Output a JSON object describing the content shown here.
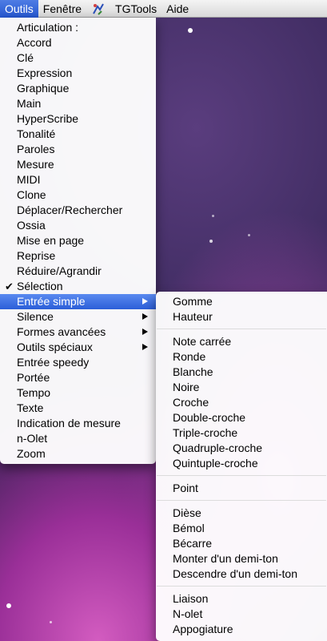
{
  "menubar": {
    "items": [
      {
        "label": "Outils",
        "active": true
      },
      {
        "label": "Fenêtre",
        "active": false
      },
      {
        "icon": "app-icon"
      },
      {
        "label": "TGTools",
        "active": false
      },
      {
        "label": "Aide",
        "active": false
      }
    ]
  },
  "tools_menu": {
    "items": [
      {
        "label": "Articulation :"
      },
      {
        "label": "Accord"
      },
      {
        "label": "Clé"
      },
      {
        "label": "Expression"
      },
      {
        "label": "Graphique"
      },
      {
        "label": "Main"
      },
      {
        "label": "HyperScribe"
      },
      {
        "label": "Tonalité"
      },
      {
        "label": "Paroles"
      },
      {
        "label": "Mesure"
      },
      {
        "label": "MIDI"
      },
      {
        "label": "Clone"
      },
      {
        "label": "Déplacer/Rechercher"
      },
      {
        "label": "Ossia"
      },
      {
        "label": "Mise en page"
      },
      {
        "label": "Reprise"
      },
      {
        "label": "Réduire/Agrandir"
      },
      {
        "label": "Sélection",
        "checked": true
      },
      {
        "label": "Entrée simple",
        "submenu": true,
        "highlighted": true
      },
      {
        "label": "Silence",
        "submenu": true
      },
      {
        "label": "Formes avancées",
        "submenu": true
      },
      {
        "label": "Outils spéciaux",
        "submenu": true
      },
      {
        "label": "Entrée speedy"
      },
      {
        "label": "Portée"
      },
      {
        "label": "Tempo"
      },
      {
        "label": "Texte"
      },
      {
        "label": "Indication de mesure"
      },
      {
        "label": "n-Olet"
      },
      {
        "label": "Zoom"
      }
    ]
  },
  "simple_entry_submenu": {
    "groups": [
      [
        "Gomme",
        "Hauteur"
      ],
      [
        "Note carrée",
        "Ronde",
        "Blanche",
        "Noire",
        "Croche",
        "Double-croche",
        "Triple-croche",
        "Quadruple-croche",
        "Quintuple-croche"
      ],
      [
        "Point"
      ],
      [
        "Dièse",
        "Bémol",
        "Bécarre",
        "Monter d'un demi-ton",
        "Descendre d'un demi-ton"
      ],
      [
        "Liaison",
        "N-olet",
        "Appogiature"
      ]
    ]
  },
  "colors": {
    "highlight": "#2b5ed8",
    "desktop_purple": "#9a2f98"
  }
}
